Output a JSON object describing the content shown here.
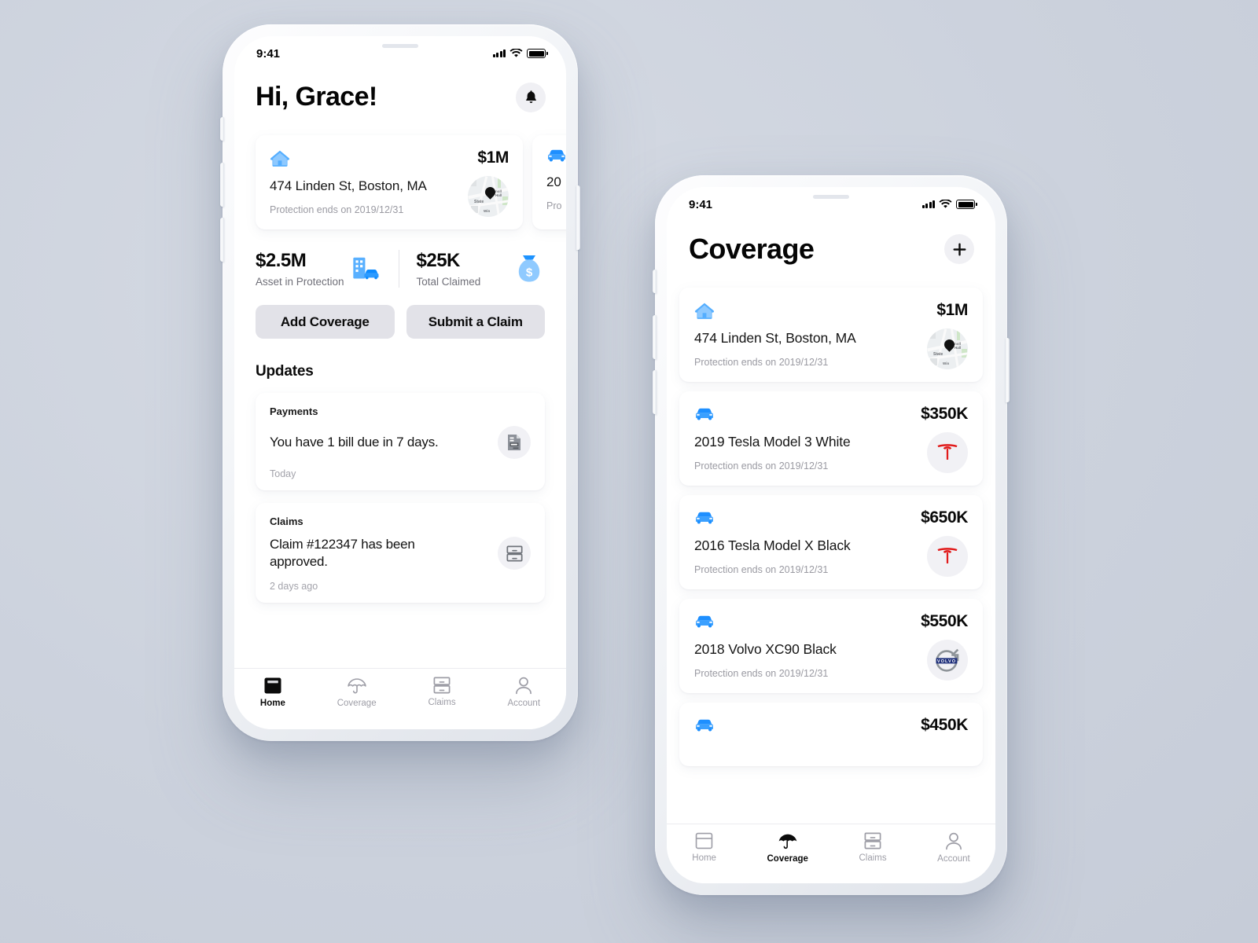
{
  "background_color": "#ccd2dd",
  "accent_blue": "#2e9bff",
  "phone_home": {
    "status_bar": {
      "time": "9:41",
      "signal_icon": "cellular-signal-icon",
      "wifi_icon": "wifi-icon",
      "battery_icon": "battery-icon"
    },
    "header": {
      "title": "Hi, Grace!",
      "notification_icon": "bell-icon"
    },
    "coverage_rail": [
      {
        "type_icon": "house-icon",
        "amount": "$1M",
        "name": "474 Linden St, Boston, MA",
        "protection": "Protection ends on 2019/12/31",
        "thumb": "map-thumbnail",
        "map_labels": [
          "State",
          "noll Hall",
          "Win"
        ]
      },
      {
        "type_icon": "car-icon",
        "amount": "",
        "name": "20",
        "protection": "Pro",
        "thumb": "car-logo-thumbnail"
      }
    ],
    "stats": [
      {
        "value": "$2.5M",
        "label": "Asset in Protection",
        "icon": "building-car-icon"
      },
      {
        "value": "$25K",
        "label": "Total Claimed",
        "icon": "money-bag-icon"
      }
    ],
    "actions": [
      {
        "label": "Add Coverage"
      },
      {
        "label": "Submit a Claim"
      }
    ],
    "updates_title": "Updates",
    "updates": [
      {
        "kicker": "Payments",
        "message": "You have 1 bill due in 7 days.",
        "time": "Today",
        "icon": "receipt-icon"
      },
      {
        "kicker": "Claims",
        "message": "Claim #122347 has been approved.",
        "time": "2 days ago",
        "icon": "file-cabinet-icon"
      }
    ],
    "tabs": [
      {
        "label": "Home",
        "icon": "home-icon",
        "active": true
      },
      {
        "label": "Coverage",
        "icon": "umbrella-icon",
        "active": false
      },
      {
        "label": "Claims",
        "icon": "file-cabinet-icon",
        "active": false
      },
      {
        "label": "Account",
        "icon": "person-icon",
        "active": false
      }
    ]
  },
  "phone_coverage": {
    "status_bar": {
      "time": "9:41",
      "signal_icon": "cellular-signal-icon",
      "wifi_icon": "wifi-icon",
      "battery_icon": "battery-icon"
    },
    "header": {
      "title": "Coverage",
      "add_icon": "plus-icon"
    },
    "items": [
      {
        "type_icon": "house-icon",
        "amount": "$1M",
        "name": "474 Linden St, Boston, MA",
        "protection": "Protection ends on 2019/12/31",
        "thumb": "map-thumbnail",
        "map_labels": [
          "State",
          "noll Hall",
          "Win"
        ]
      },
      {
        "type_icon": "car-icon",
        "amount": "$350K",
        "name": "2019 Tesla Model 3 White",
        "protection": "Protection ends on 2019/12/31",
        "thumb": "tesla-logo"
      },
      {
        "type_icon": "car-icon",
        "amount": "$650K",
        "name": "2016 Tesla Model X Black",
        "protection": "Protection ends on 2019/12/31",
        "thumb": "tesla-logo"
      },
      {
        "type_icon": "car-icon",
        "amount": "$550K",
        "name": "2018 Volvo XC90 Black",
        "protection": "Protection ends on 2019/12/31",
        "thumb": "volvo-logo"
      },
      {
        "type_icon": "car-icon",
        "amount": "$450K",
        "name": "",
        "protection": "",
        "thumb": ""
      }
    ],
    "tabs": [
      {
        "label": "Home",
        "icon": "home-icon",
        "active": false
      },
      {
        "label": "Coverage",
        "icon": "umbrella-icon",
        "active": true
      },
      {
        "label": "Claims",
        "icon": "file-cabinet-icon",
        "active": false
      },
      {
        "label": "Account",
        "icon": "person-icon",
        "active": false
      }
    ]
  }
}
